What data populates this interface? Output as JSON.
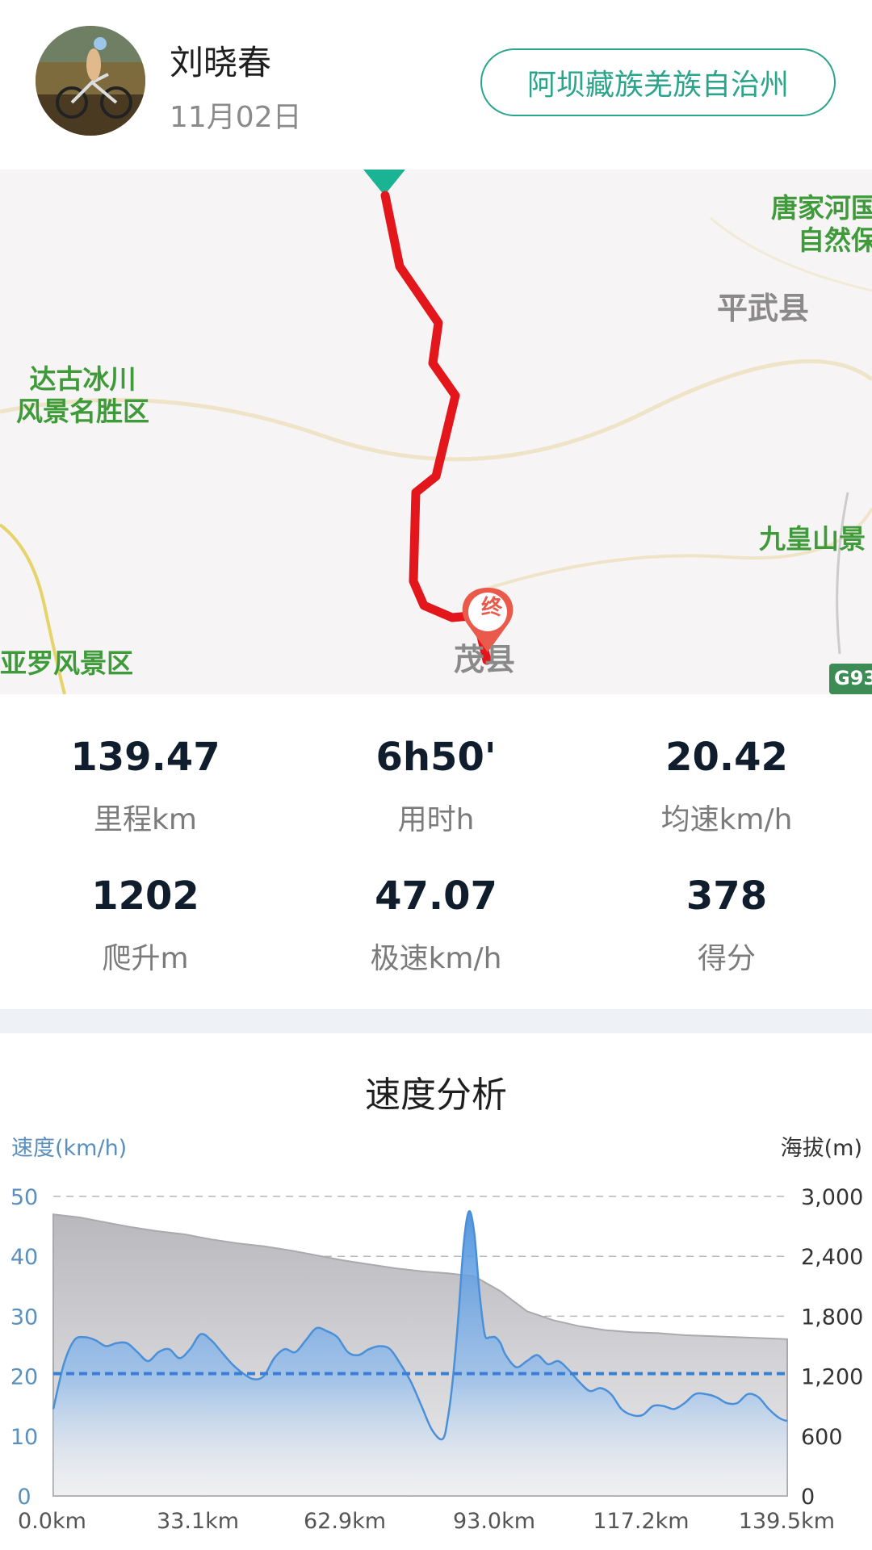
{
  "header": {
    "user_name": "刘晓春",
    "ride_date": "11月02日",
    "region_button": "阿坝藏族羌族自治州"
  },
  "map": {
    "labels": {
      "dagu": "达古冰川\n风景名胜区",
      "tangjiahe": "唐家河国\n自然保",
      "pingwu": "平武县",
      "jiuhuangshan": "九皇山景",
      "yaluo": "亚罗风景区",
      "maoxian": "茂县"
    },
    "end_marker": "终",
    "road_badge": "G93",
    "route_color": "#e3171b",
    "start_color": "#1ab394"
  },
  "stats": [
    {
      "value": "139.47",
      "label": "里程km"
    },
    {
      "value": "6h50'",
      "label": "用时h"
    },
    {
      "value": "20.42",
      "label": "均速km/h"
    },
    {
      "value": "1202",
      "label": "爬升m"
    },
    {
      "value": "47.07",
      "label": "极速km/h"
    },
    {
      "value": "378",
      "label": "得分"
    }
  ],
  "chart_data": {
    "type": "area",
    "title": "速度分析",
    "ylabel_left": "速度(km/h)",
    "ylabel_right": "海拔(m)",
    "y_left_ticks": [
      "50",
      "40",
      "30",
      "20",
      "10",
      "0"
    ],
    "y_right_ticks": [
      "3,000",
      "2,400",
      "1,800",
      "1,200",
      "600",
      "0"
    ],
    "x_tick_labels": [
      "0.0km",
      "33.1km",
      "62.9km",
      "93.0km",
      "117.2km",
      "139.5km"
    ],
    "ylim_left": [
      0,
      50
    ],
    "ylim_right": [
      0,
      3000
    ],
    "xlim": [
      0,
      139.5
    ],
    "average_speed": 20.42,
    "grid": true,
    "series": [
      {
        "name": "速度",
        "axis": "left",
        "color": "#4a90d9",
        "x": [
          0,
          2,
          4,
          6,
          8,
          10,
          12,
          14,
          16,
          18,
          20,
          22,
          24,
          26,
          28,
          30,
          32,
          34,
          36,
          38,
          40,
          42,
          44,
          46,
          48,
          50,
          52,
          54,
          56,
          58,
          60,
          62,
          64,
          66,
          68,
          70,
          72,
          74,
          75,
          76,
          77,
          78,
          79,
          80,
          81,
          82,
          83,
          84,
          85,
          86,
          88,
          90,
          92,
          94,
          96,
          98,
          100,
          102,
          104,
          106,
          108,
          110,
          112,
          114,
          116,
          118,
          120,
          122,
          124,
          126,
          128,
          130,
          132,
          134,
          136,
          138,
          139.5
        ],
        "values": [
          14.5,
          22,
          26,
          26.5,
          26,
          25,
          25.5,
          25.5,
          24,
          22.5,
          24,
          24.5,
          23,
          24.5,
          27,
          26,
          24,
          22,
          20.5,
          19.5,
          20,
          23,
          24.5,
          24,
          26,
          28,
          27.5,
          26.5,
          24,
          23.5,
          24.5,
          25,
          24.5,
          22,
          19,
          15,
          11,
          9.5,
          13,
          20,
          30,
          42,
          47.5,
          44,
          34,
          27,
          26.5,
          26.5,
          25.5,
          23.5,
          21.5,
          22.5,
          23.5,
          22,
          22.5,
          21,
          19,
          17.5,
          18,
          17,
          14.5,
          13.5,
          13.5,
          15,
          15,
          14.5,
          15.5,
          17,
          17,
          16.5,
          15.5,
          15.5,
          17,
          16.5,
          14.5,
          13,
          12.5
        ]
      },
      {
        "name": "海拔",
        "axis": "right",
        "color": "#c4c4c8",
        "x": [
          0,
          5,
          10,
          15,
          20,
          25,
          30,
          35,
          40,
          45,
          50,
          55,
          60,
          65,
          70,
          75,
          80,
          85,
          90,
          95,
          100,
          105,
          110,
          115,
          120,
          125,
          130,
          135,
          139.5
        ],
        "values": [
          2820,
          2790,
          2740,
          2690,
          2650,
          2620,
          2570,
          2530,
          2500,
          2460,
          2410,
          2360,
          2320,
          2280,
          2250,
          2230,
          2200,
          2050,
          1850,
          1760,
          1700,
          1660,
          1640,
          1630,
          1610,
          1600,
          1590,
          1580,
          1570
        ]
      }
    ]
  }
}
